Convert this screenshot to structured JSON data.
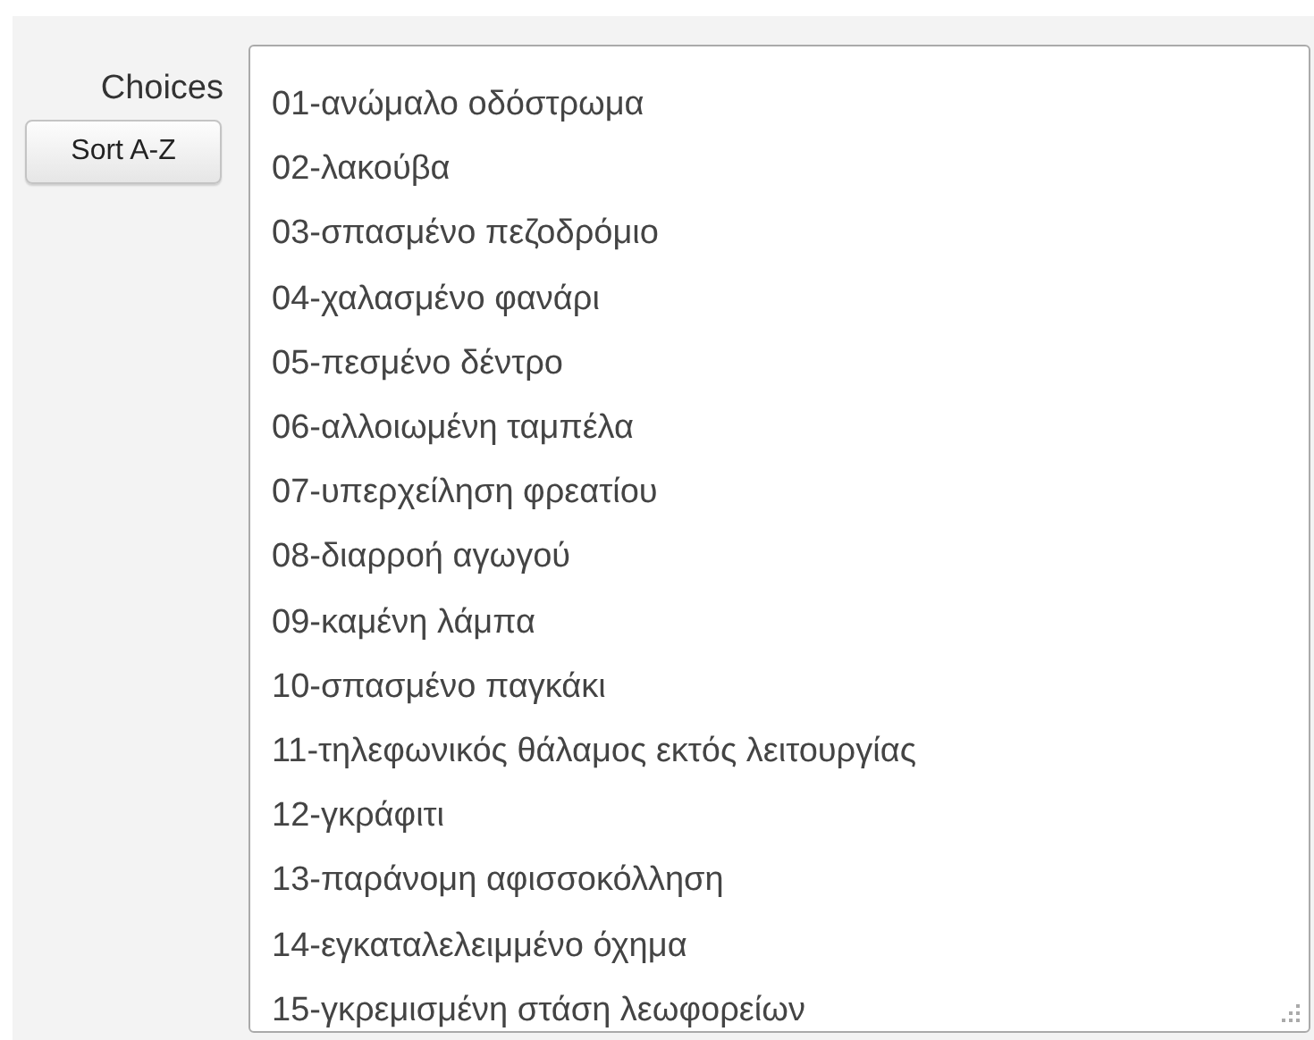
{
  "label": "Choices",
  "sort_button": "Sort A-Z",
  "choices": [
    "01-ανώμαλο οδόστρωμα",
    "02-λακούβα",
    "03-σπασμένο πεζοδρόμιο",
    "04-χαλασμένο φανάρι",
    "05-πεσμένο δέντρο",
    "06-αλλοιωμένη ταμπέλα",
    "07-υπερχείληση φρεατίου",
    "08-διαρροή αγωγού",
    "09-καμένη λάμπα",
    "10-σπασμένο παγκάκι",
    "11-τηλεφωνικός θάλαμος εκτός λειτουργίας",
    "12-γκράφιτι",
    "13-παράνομη αφισσοκόλληση",
    "14-εγκαταλελειμμένο όχημα",
    "15-γκρεμισμένη στάση λεωφορείων"
  ]
}
